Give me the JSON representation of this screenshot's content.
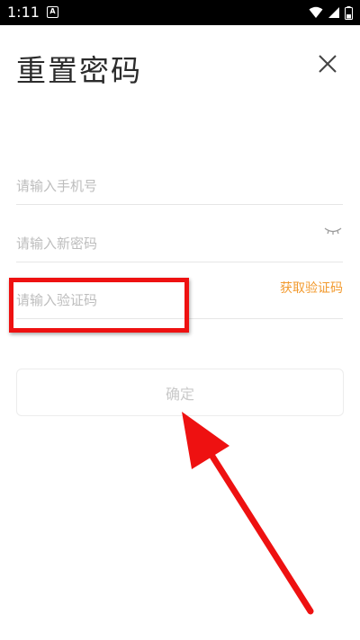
{
  "status_bar": {
    "time": "1:11",
    "notification_glyph": "A",
    "icons": [
      "wifi-icon",
      "signal-icon",
      "battery-icon"
    ]
  },
  "page": {
    "title": "重置密码",
    "close_icon": "close-icon"
  },
  "form": {
    "phone": {
      "value": "",
      "placeholder": "请输入手机号"
    },
    "password": {
      "value": "",
      "placeholder": "请输入新密码",
      "toggle_icon": "eye-closed-icon"
    },
    "code": {
      "value": "",
      "placeholder": "请输入验证码",
      "get_code_label": "获取验证码"
    },
    "confirm_label": "确定"
  },
  "colors": {
    "accent": "#f29a2e",
    "annotation_red": "#ee1111",
    "disabled_text": "#c9c9c9"
  }
}
